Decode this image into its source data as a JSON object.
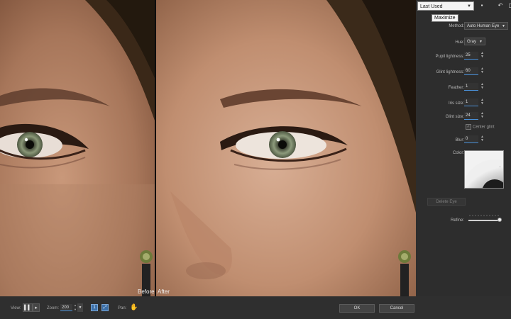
{
  "preview": {
    "before_label": "Before",
    "after_label": "After"
  },
  "panel": {
    "preset_value": "Last Used",
    "tooltip": "Maximize",
    "top_icons": [
      "save-preset-icon",
      "reset-icon",
      "more-icon"
    ],
    "method": {
      "label": "Method:",
      "value": "Auto Human Eye"
    },
    "hue": {
      "label": "Hue:",
      "value": "Gray"
    },
    "pupil_lightness": {
      "label": "Pupil lightness:",
      "value": "25"
    },
    "glint_lightness": {
      "label": "Glint lightness:",
      "value": "60"
    },
    "feather": {
      "label": "Feather:",
      "value": "1"
    },
    "iris_size": {
      "label": "Iris size:",
      "value": "1"
    },
    "glint_size": {
      "label": "Glint size:",
      "value": "24"
    },
    "center_glint": {
      "label": "Center glint",
      "checked": true
    },
    "blur": {
      "label": "Blur:",
      "value": "0"
    },
    "color_label": "Color:",
    "delete_eye": "Delete Eye",
    "refine": {
      "label": "Refine:",
      "value": 1.0
    }
  },
  "bottom": {
    "view_label": "View:",
    "zoom_label": "Zoom:",
    "zoom_value": "200",
    "pan_label": "Pan:",
    "ok_label": "OK",
    "cancel_label": "Cancel"
  },
  "colors": {
    "accent": "#4a8fd6",
    "panel_bg": "#2d2d2d",
    "skin_light": "#c99a7c",
    "skin_dark": "#8c5f45",
    "hair": "#3b2a1a",
    "iris": "#7d8a6a"
  }
}
